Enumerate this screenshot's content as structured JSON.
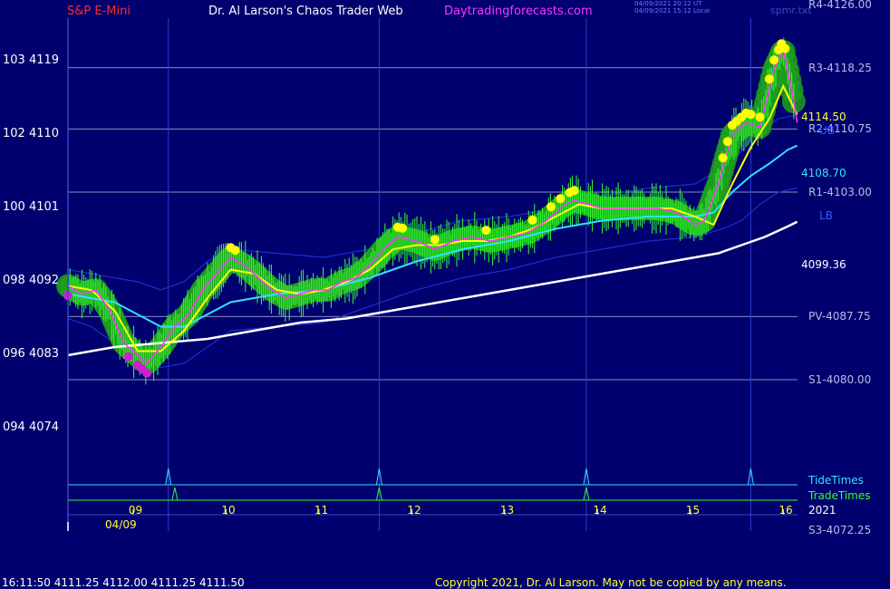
{
  "header": {
    "symbol": "S&P E-Mini",
    "title": "Dr. Al Larson's Chaos Trader Web",
    "site": "Daytradingforecasts.com",
    "stamp_ut": "04/09/2021 20:12 UT",
    "stamp_local": "04/09/2021 15:12 Local",
    "tag": "spmr.txt"
  },
  "footer": {
    "quote": "16:11:50  4111.25 4112.00 4111.25 4111.50",
    "copyright": "Copyright 2021, Dr. Al Larson. May not be copied by any means."
  },
  "colors": {
    "background": "#00006e",
    "price_bars": "#33ff33",
    "halo": "#1f9e1f",
    "fast_ma": "#ff33ff",
    "slow_ma": "#ffff00",
    "trend_ma": "#33e0ff",
    "long_ma": "#ffffff",
    "band": "#1f2ccc",
    "tide_times": "#33e0ff",
    "trade_times": "#33ff33",
    "level_lines": "#b8bce6",
    "tick_text": "#ffff33"
  },
  "chart_data": {
    "type": "line",
    "title": "S&P E-Mini",
    "ylim": [
      4072.25,
      4126.0
    ],
    "xlim": [
      8.25,
      16.1
    ],
    "y_ticks": [
      {
        "value": 4119,
        "label": "103  4119"
      },
      {
        "value": 4110,
        "label": "102  4110"
      },
      {
        "value": 4101,
        "label": "100  4101"
      },
      {
        "value": 4092,
        "label": "098  4092"
      },
      {
        "value": 4083,
        "label": "096  4083"
      },
      {
        "value": 4074,
        "label": "094  4074"
      }
    ],
    "x_ticks": [
      {
        "value": 9,
        "label": "09"
      },
      {
        "value": 10,
        "label": "10"
      },
      {
        "value": 11,
        "label": "11"
      },
      {
        "value": 12,
        "label": "12"
      },
      {
        "value": 13,
        "label": "13"
      },
      {
        "value": 14,
        "label": "14"
      },
      {
        "value": 15,
        "label": "15"
      },
      {
        "value": 16,
        "label": "16"
      }
    ],
    "date_label": "04/09",
    "year_label": "2021",
    "levels": [
      {
        "label": "R4-4126.00",
        "value": 4126.0
      },
      {
        "label": "R3-4118.25",
        "value": 4118.25
      },
      {
        "label": "R2-4110.75",
        "value": 4110.75
      },
      {
        "label": "R1-4103.00",
        "value": 4103.0
      },
      {
        "label": "PV-4087.75",
        "value": 4087.75
      },
      {
        "label": "S1-4080.00",
        "value": 4080.0
      },
      {
        "label": "S3-4072.25",
        "value": 4072.25
      }
    ],
    "value_labels": [
      {
        "label": "4114.50",
        "value": 4114.5
      },
      {
        "label": "4108.70",
        "value": 4108.7
      },
      {
        "label": "4099.36",
        "value": 4099.36
      }
    ],
    "band_labels": {
      "upper": "UB",
      "lower": "LB"
    },
    "time_markers": {
      "tide_label": "TideTimes",
      "trade_label": "TradeTimes",
      "tide_times": [
        9.33,
        11.6,
        13.83,
        15.6
      ],
      "trade_times": [
        9.4,
        11.6,
        13.83
      ]
    },
    "series": [
      {
        "name": "price",
        "x": [
          8.25,
          8.4,
          8.55,
          8.7,
          8.85,
          9.0,
          9.1,
          9.25,
          9.4,
          9.55,
          9.7,
          9.85,
          10.0,
          10.15,
          10.3,
          10.45,
          10.6,
          10.75,
          10.9,
          11.05,
          11.2,
          11.35,
          11.5,
          11.65,
          11.8,
          12.0,
          12.2,
          12.4,
          12.6,
          12.8,
          13.0,
          13.2,
          13.4,
          13.6,
          13.7,
          13.85,
          14.0,
          14.2,
          14.4,
          14.6,
          14.8,
          15.0,
          15.1,
          15.25,
          15.4,
          15.55,
          15.7,
          15.85,
          15.95,
          16.05,
          16.1
        ],
        "y": [
          4091.5,
          4090.5,
          4091.0,
          4088.5,
          4084.5,
          4083.0,
          4082.0,
          4084.0,
          4086.5,
          4088.0,
          4091.0,
          4093.0,
          4095.0,
          4094.0,
          4092.5,
          4091.0,
          4090.0,
          4090.5,
          4091.0,
          4091.0,
          4092.0,
          4092.5,
          4094.0,
          4096.0,
          4097.5,
          4097.0,
          4096.0,
          4097.0,
          4097.5,
          4097.0,
          4097.5,
          4098.0,
          4099.5,
          4101.5,
          4102.0,
          4101.5,
          4101.0,
          4101.0,
          4101.0,
          4101.0,
          4100.5,
          4099.0,
          4099.5,
          4104.0,
          4110.0,
          4111.5,
          4111.0,
          4118.0,
          4120.5,
          4115.0,
          4111.5
        ]
      },
      {
        "name": "MA-slow",
        "x": [
          8.25,
          8.5,
          8.75,
          9.0,
          9.25,
          9.5,
          9.75,
          10.0,
          10.25,
          10.5,
          10.75,
          11.0,
          11.25,
          11.5,
          11.75,
          12.0,
          12.25,
          12.5,
          12.75,
          13.0,
          13.25,
          13.5,
          13.75,
          14.0,
          14.25,
          14.5,
          14.75,
          15.0,
          15.2,
          15.4,
          15.6,
          15.8,
          15.95,
          16.1
        ],
        "y": [
          4091.5,
          4091.0,
          4088.5,
          4083.5,
          4083.5,
          4086.0,
          4090.0,
          4093.5,
          4093.0,
          4091.0,
          4090.5,
          4091.0,
          4092.0,
          4093.5,
          4096.0,
          4096.5,
          4096.5,
          4097.0,
          4097.0,
          4097.5,
          4098.5,
          4100.0,
          4101.5,
          4101.0,
          4101.0,
          4101.0,
          4101.0,
          4100.0,
          4099.0,
          4104.0,
          4108.5,
          4112.0,
          4116.0,
          4112.5
        ]
      },
      {
        "name": "MA-trend",
        "x": [
          8.25,
          8.75,
          9.0,
          9.25,
          9.5,
          9.75,
          10.0,
          10.5,
          11.0,
          11.5,
          12.0,
          12.5,
          13.0,
          13.5,
          14.0,
          14.5,
          15.0,
          15.2,
          15.4,
          15.6,
          15.8,
          16.0,
          16.1
        ],
        "y": [
          4090.5,
          4089.5,
          4088.0,
          4086.5,
          4086.5,
          4088.0,
          4089.5,
          4090.5,
          4091.0,
          4092.5,
          4094.5,
          4096.0,
          4097.0,
          4098.5,
          4099.5,
          4100.0,
          4100.0,
          4100.5,
          4103.0,
          4105.0,
          4106.5,
          4108.2,
          4108.7
        ]
      },
      {
        "name": "MA-long",
        "x": [
          8.25,
          8.75,
          9.25,
          9.75,
          10.25,
          10.75,
          11.25,
          11.75,
          12.25,
          12.75,
          13.25,
          13.75,
          14.25,
          14.75,
          15.25,
          15.5,
          15.75,
          16.0,
          16.1
        ],
        "y": [
          4083.0,
          4084.0,
          4084.5,
          4085.0,
          4086.0,
          4087.0,
          4087.5,
          4088.5,
          4089.5,
          4090.5,
          4091.5,
          4092.5,
          4093.5,
          4094.5,
          4095.5,
          4096.5,
          4097.5,
          4098.8,
          4099.36
        ]
      },
      {
        "name": "band-upper",
        "x": [
          8.25,
          8.5,
          8.75,
          9.0,
          9.25,
          9.5,
          9.75,
          10.0,
          10.5,
          11.0,
          11.5,
          12.0,
          12.5,
          13.0,
          13.5,
          14.0,
          14.5,
          15.0,
          15.3,
          15.5,
          15.7,
          15.9,
          16.1
        ],
        "y": [
          4093.5,
          4093.0,
          4092.5,
          4092.0,
          4091.0,
          4092.0,
          4094.5,
          4096.0,
          4095.5,
          4095.0,
          4096.0,
          4098.0,
          4099.5,
          4100.0,
          4101.0,
          4102.5,
          4103.5,
          4104.0,
          4106.0,
          4108.0,
          4110.5,
          4112.0,
          4112.5
        ]
      },
      {
        "name": "band-lower",
        "x": [
          8.25,
          8.5,
          8.75,
          9.0,
          9.25,
          9.5,
          9.75,
          10.0,
          10.5,
          11.0,
          11.5,
          12.0,
          12.5,
          13.0,
          13.5,
          14.0,
          14.5,
          15.0,
          15.3,
          15.5,
          15.7,
          15.9,
          16.1
        ],
        "y": [
          4087.5,
          4086.5,
          4084.5,
          4082.5,
          4081.5,
          4082.0,
          4084.0,
          4086.0,
          4086.5,
          4087.0,
          4089.0,
          4091.0,
          4092.5,
          4093.5,
          4095.0,
          4096.0,
          4097.0,
          4097.5,
          4098.5,
          4099.5,
          4101.5,
          4103.0,
          4103.5
        ]
      }
    ]
  }
}
